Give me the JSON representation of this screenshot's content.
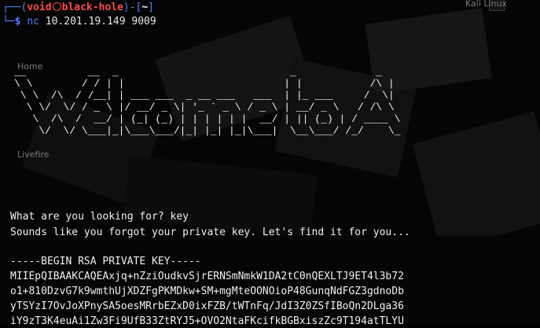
{
  "desktop": {
    "label_top_right": "Kali Linux",
    "label_left_1": "Home",
    "label_left_2": "Livefire"
  },
  "prompt": {
    "user": "void",
    "host": "black-hole",
    "dir": "~",
    "dollar": "$",
    "command": "nc",
    "args": "10.201.19.149 9009"
  },
  "banner": [
    "__          __  _                            _             _    ",
    "\\ \\        / / | |                          | |           /\\ |",
    " \\ \\  /\\  / /__| | ___ ___  _ __ ___   ___  | |_ ___     /  \\|",
    "  \\ \\/  \\/ / _ \\ |/ __/ _ \\| '_ ` _ \\ / _ \\ | __/ _ \\   / /\\ \\",
    "   \\  /\\  /  __/ | (_| (_) | | | | | |  __/ | || (_) | / ____ \\",
    "    \\/  \\/ \\___|_|\\___\\___/|_| |_| |_|\\___|  \\__\\___/ /_/    \\_"
  ],
  "output": {
    "question": "What are you looking for? key",
    "response": "Sounds like you forgot your private key. Let's find it for you...",
    "key_header": "-----BEGIN RSA PRIVATE KEY-----",
    "key_lines": [
      "MIIEpQIBAAKCAQEAxjq+nZziOudkvSjrERNSmNmkW1DA2tC0nQEXLTJ9ET4l3b72",
      "o1+810DzvG7k9wmthUjXDZFgPKMDkw+SM+mgMteOONOioP48GunqNdFGZ3gdnoDb",
      "yTSYzI7OvJoXPnySA5oesMRrbEZxD0ixFZB/tWTnFq/JdI3Z0ZSfIBoQn2DLga36",
      "iY9zT3K4euAi1Zw3Fi9UfB33ZtRYJ5+OVO2NtaFKcifkBGBxiszZc9T194atTLYU"
    ]
  }
}
